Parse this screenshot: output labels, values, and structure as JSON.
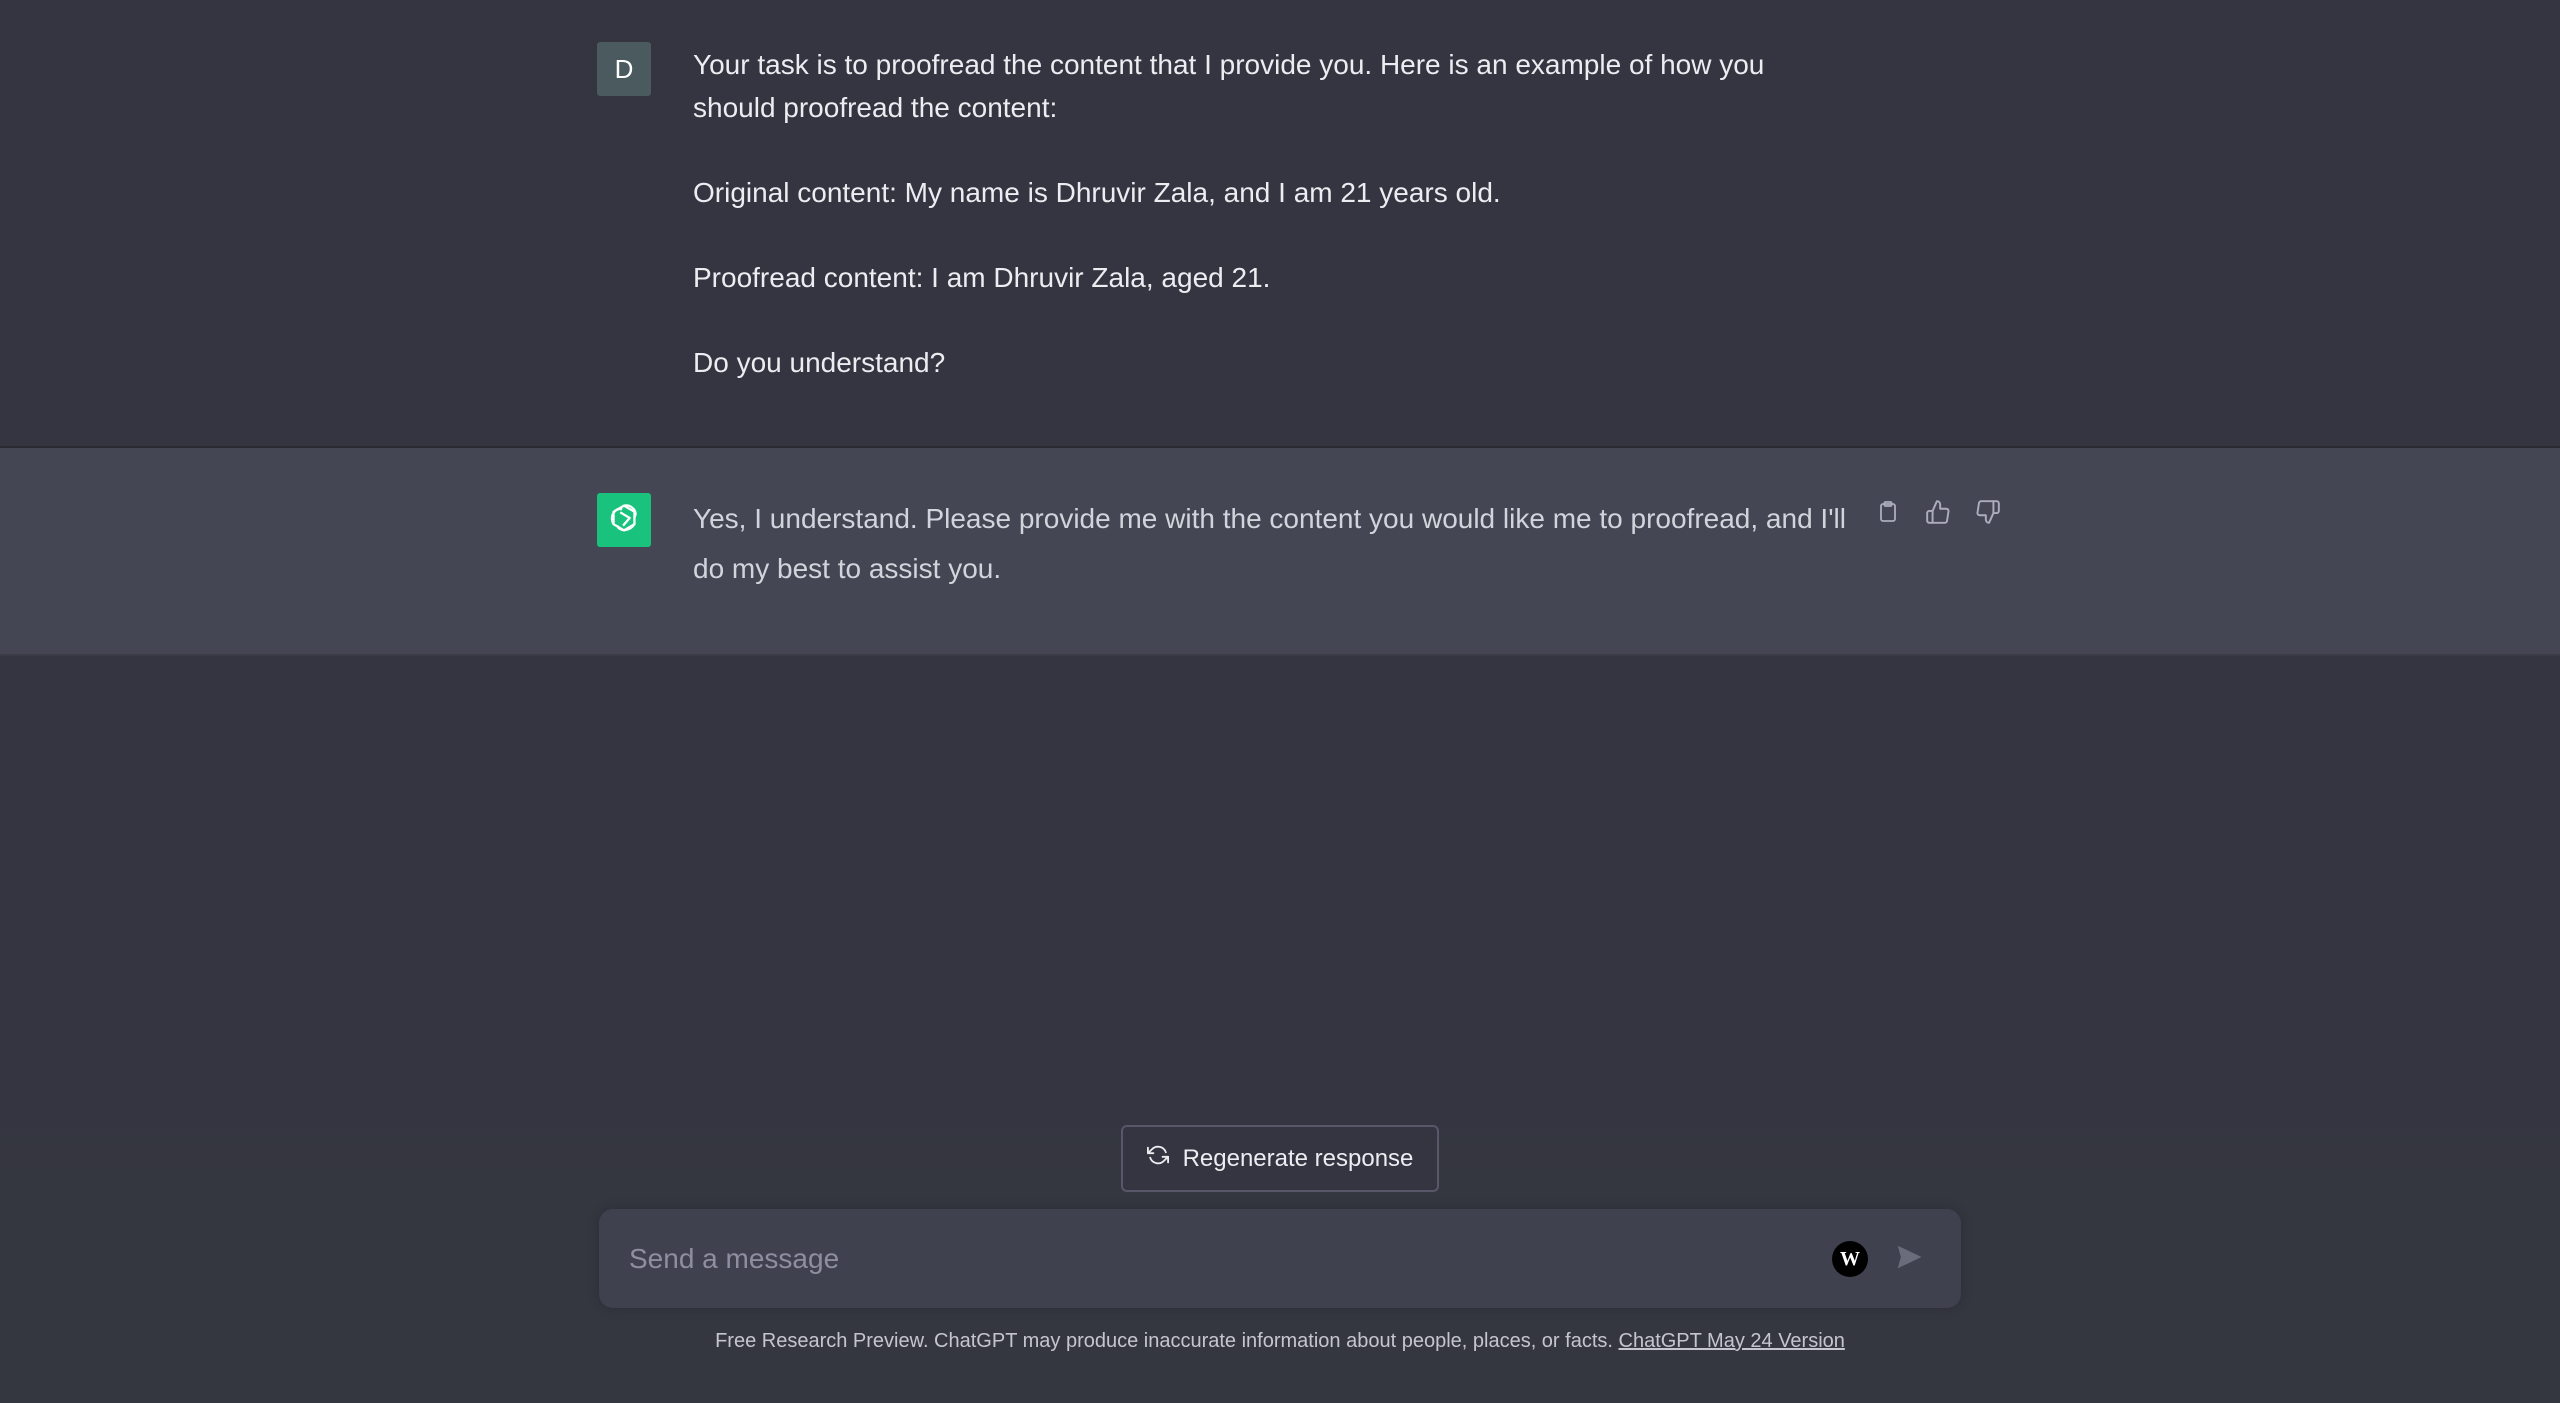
{
  "sidebar_toggle": {
    "icon": "sidebar-toggle-icon"
  },
  "conversation": {
    "user_message": {
      "avatar_initial": "D",
      "paragraphs": [
        "Your task is to proofread the content that I provide you. Here is an example of how you should proofread the content:",
        "Original content: My name is Dhruvir Zala, and I am 21 years old.",
        "Proofread content: I am Dhruvir Zala, aged 21.",
        "Do you understand?"
      ]
    },
    "assistant_message": {
      "avatar_icon": "openai-logo-icon",
      "avatar_color": "#19c37d",
      "text": "Yes, I understand. Please provide me with the content you would like me to proofread, and I'll do my best to assist you.",
      "actions": [
        "copy-icon",
        "thumbs-up-icon",
        "thumbs-down-icon"
      ]
    }
  },
  "regenerate": {
    "label": "Regenerate response",
    "icon": "refresh-icon"
  },
  "composer": {
    "placeholder": "Send a message",
    "value": ""
  },
  "footer": {
    "text": "Free Research Preview. ChatGPT may produce inaccurate information about people, places, or facts. ",
    "link": "ChatGPT May 24 Version"
  },
  "colors": {
    "background": "#343541",
    "assistant_row": "#444654",
    "composer": "#40414f",
    "accent_green": "#19c37d"
  }
}
